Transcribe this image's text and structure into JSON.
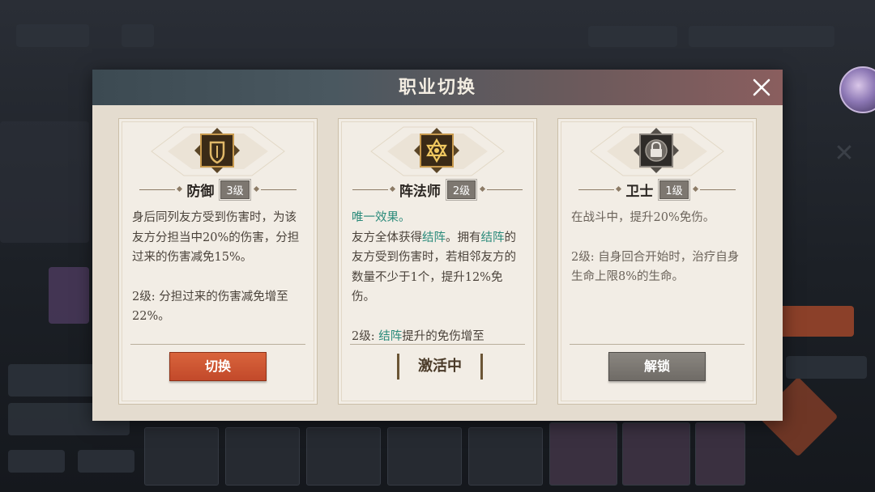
{
  "modal": {
    "title": "职业切换"
  },
  "cards": [
    {
      "name": "防御",
      "level": "3级",
      "emblem_icon": "shield-icon",
      "desc": [
        "身后同列友方受到伤害时，为该友方分担当中20%的伤害，分担过来的伤害减免15%。",
        "2级: 分担过来的伤害减免增至22%。"
      ],
      "action": {
        "type": "button",
        "label": "切换"
      }
    },
    {
      "name": "阵法师",
      "level": "2级",
      "emblem_icon": "hexagram-icon",
      "desc_unique": "唯一效果。",
      "desc_parts": [
        "友方全体获得",
        "结阵",
        "。拥有",
        "结阵",
        "的友方受到伤害时，若相邻友方的数量不少于1个，提升12%免伤。"
      ],
      "desc_lv2_parts": [
        "2级: ",
        "结阵",
        "提升的免伤增至"
      ],
      "action": {
        "type": "status",
        "label": "激活中"
      }
    },
    {
      "name": "卫士",
      "level": "1级",
      "emblem_icon": "lock-icon",
      "desc": [
        "在战斗中，提升20%免伤。",
        "2级: 自身回合开始时，治疗自身生命上限8%的生命。"
      ],
      "action": {
        "type": "button",
        "label": "解锁"
      }
    }
  ],
  "colors": {
    "highlight": "#2a8a7a",
    "switch_button": "#c9512f",
    "unlock_button": "#7b7772",
    "header_left": "#3c4a52",
    "header_right": "#8a5e5e"
  }
}
